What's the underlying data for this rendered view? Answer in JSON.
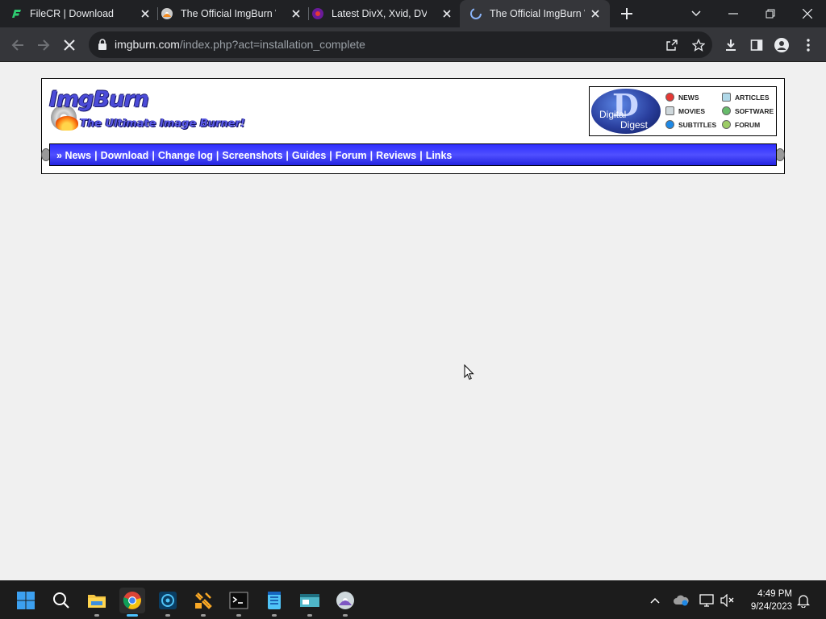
{
  "browser": {
    "tabs": [
      {
        "title": "FileCR | Download",
        "active": false
      },
      {
        "title": "The Official ImgBurn W",
        "active": false
      },
      {
        "title": "Latest DivX, Xvid, DVD,",
        "active": false
      },
      {
        "title": "The Official ImgBurn W",
        "active": true
      }
    ],
    "url_host": "imgburn.com",
    "url_path": "/index.php?act=installation_complete"
  },
  "page": {
    "logo_title": "ImgBurn",
    "logo_tagline": "The Ultimate Image Burner!",
    "digital_digest": {
      "logo_line1": "Digital",
      "logo_line2": "Digest",
      "links": [
        "NEWS",
        "ARTICLES",
        "MOVIES",
        "SOFTWARE",
        "SUBTITLES",
        "FORUM"
      ]
    },
    "nav": {
      "prefix": "»",
      "items": [
        "News",
        "Download",
        "Change log",
        "Screenshots",
        "Guides",
        "Forum",
        "Reviews",
        "Links"
      ]
    }
  },
  "taskbar": {
    "time": "4:49 PM",
    "date": "9/24/2023"
  },
  "colors": {
    "nav_bar": "#3b3bff",
    "chrome_dark": "#202124",
    "toolbar": "#35363a",
    "page_bg": "#f0f0f0"
  }
}
